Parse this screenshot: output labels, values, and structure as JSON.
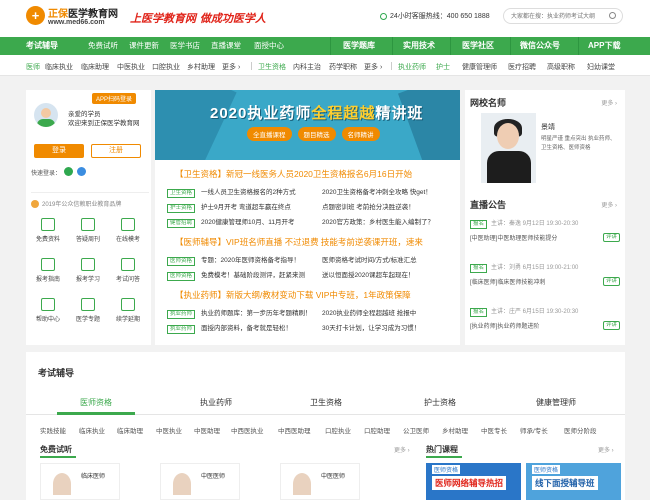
{
  "header": {
    "logo_brand": "正保",
    "logo_title": "医学教育网",
    "logo_domain": "www.med66.com",
    "slogan": "上医学教育网 做成功医学人",
    "phone_label": "24小时客服热线：400 650 1888",
    "search_placeholder": "大家都在搜：执业药师考试大纲"
  },
  "nav": [
    "考试辅导",
    "免费试听",
    "课件更新",
    "医学书店",
    "直播课堂",
    "面授中心",
    "医学题库",
    "实用技术",
    "医学社区",
    "微信公众号",
    "APP下载"
  ],
  "subnav": {
    "group1": [
      "医师",
      "临床执业",
      "临床助理",
      "中医执业",
      "口腔执业",
      "乡村助理",
      "更多 ›"
    ],
    "group2": [
      "卫生资格",
      "内科主治",
      "药学职称",
      "更多 ›"
    ],
    "group3": [
      "执业药师",
      "护士",
      "健康管理师",
      "医疗招聘",
      "高级职称",
      "妇幼课堂"
    ]
  },
  "user": {
    "app_tip": "APP扫码登录",
    "greeting": "亲爱的学员",
    "welcome": "欢迎来到正保医学教育网",
    "login": "登录",
    "register": "注册",
    "quick_login": "快速登录：",
    "brand_note": "2019年公众信赖职业教育品牌"
  },
  "tiles": [
    "免费资料",
    "答疑周刊",
    "在线模考",
    "报考指南",
    "报考学习",
    "考试问答",
    "帮助中心",
    "医学专题",
    "续学延期"
  ],
  "banner": {
    "title_a": "2020执业药师",
    "title_b": "全程超越",
    "title_c": "精讲班",
    "tags": [
      "全直播课程",
      "题目精选",
      "名师精讲"
    ]
  },
  "news": [
    {
      "headline": "【卫生资格】新冠一线医务人员2020卫生资格报名6月16日开始",
      "rows": [
        {
          "tag": "卫生资格",
          "left": "一线人员卫生资格报名的2种方式",
          "right": "2020卫生资格备考冲刺全攻略 快get！"
        },
        {
          "tag": "护士资格",
          "left": "护士9月开考 弯道超车赢在终点",
          "right": "点题密训班 考前抢分决胜逆袭！"
        },
        {
          "tag": "健管招聘",
          "left": "2020健康管理师10月、11月开考",
          "right": "2020官方政策：乡村医生能入编制了？"
        }
      ]
    },
    {
      "headline": "【医师辅导】VIP班名师直播 不过退费   技能考前逆袭课开班，速来",
      "rows": [
        {
          "tag": "医师资格",
          "left": "专题：2020年医师资格备考指导！",
          "right": "医师资格考试时间/方式/标准汇总"
        },
        {
          "tag": "医师资格",
          "left": "免费模考！基础阶段测评，赶紧来测",
          "right": "送以恒面授2020课超车起现在！"
        }
      ]
    },
    {
      "headline": "【执业药师】新版大纲/教材变动下载   VIP中专班，1年政策保障",
      "rows": [
        {
          "tag": "执业药师",
          "left": "执业药师题库：第一步历年考题精刷！",
          "right": "2020执业药师全程超越班 抢报中"
        },
        {
          "tag": "执业药师",
          "left": "面授内部资料，备考就是轻松！",
          "right": "30天打卡计划，让学习成为习惯！"
        }
      ]
    }
  ],
  "teacher": {
    "section_title": "网校名师",
    "more": "更多 ›",
    "name": "景靖",
    "desc": "明星严谨 重点突出 执业药师、卫生资格、医师资格"
  },
  "live": {
    "section_title": "直播公告",
    "more": "更多 ›",
    "items": [
      {
        "tag": "报名",
        "meta": "主讲：秦逸 9月12日 19:30-20:30",
        "title": "[中医助理]中医助理医师技能提分",
        "status": "评讲"
      },
      {
        "tag": "报名",
        "meta": "主讲：刘勇 6月15日 19:00-21:00",
        "title": "[临床医师]临床医师技能冲刺",
        "status": "评讲"
      },
      {
        "tag": "报名",
        "meta": "主讲：庄严 6月15日 19:30-20:30",
        "title": "[执业药师]执业药师题进阶",
        "status": "评讲"
      }
    ]
  },
  "guide": {
    "title": "考试辅导",
    "tabs": [
      "医师资格",
      "执业药师",
      "卫生资格",
      "护士资格",
      "健康管理师"
    ],
    "links": [
      "实践技能",
      "临床执业",
      "临床助理",
      "中医执业",
      "中医助理",
      "中西医执业",
      "中西医助理",
      "口腔执业",
      "口腔助理",
      "公卫医师",
      "乡村助理",
      "中医专长",
      "师承/专长",
      "医师分阶段"
    ],
    "free_title": "免费试听",
    "hot_title": "热门课程",
    "more": "更多 ›",
    "trials": [
      "临床医师",
      "中医医师",
      "中医医师"
    ],
    "courses": [
      {
        "head": "医师资格",
        "title": "医师网络辅导热招"
      },
      {
        "head": "医师资格",
        "title": "线下面授辅导班"
      }
    ]
  },
  "colors": {
    "green": "#3ca94d",
    "orange": "#f08a00",
    "red": "#e0241a"
  }
}
